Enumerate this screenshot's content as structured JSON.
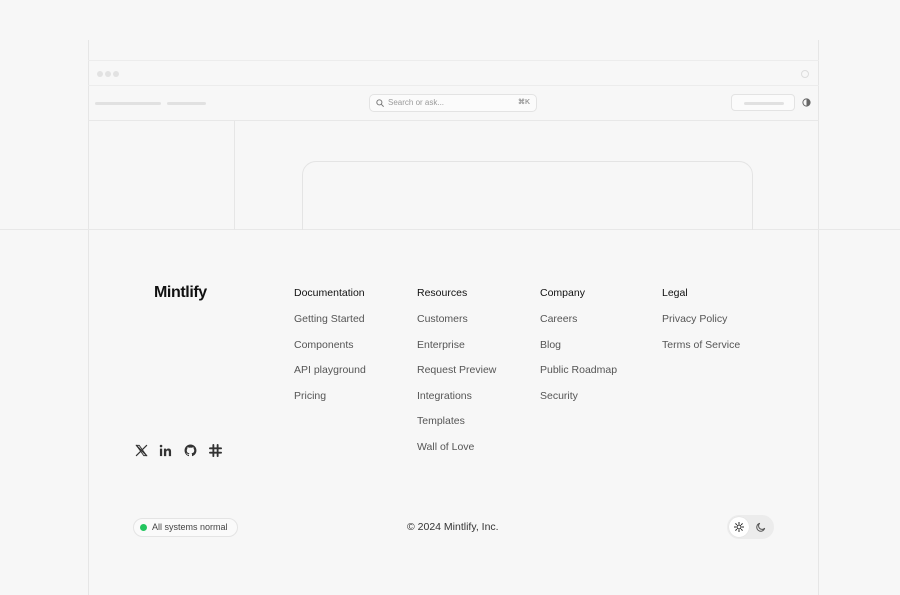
{
  "mock_window": {
    "search_placeholder": "Search or ask...",
    "search_shortcut": "⌘K"
  },
  "footer": {
    "logo": "Mintlify",
    "columns": [
      {
        "heading": "Documentation",
        "links": [
          "Getting Started",
          "Components",
          "API playground",
          "Pricing"
        ]
      },
      {
        "heading": "Resources",
        "links": [
          "Customers",
          "Enterprise",
          "Request Preview",
          "Integrations",
          "Templates",
          "Wall of Love"
        ]
      },
      {
        "heading": "Company",
        "links": [
          "Careers",
          "Blog",
          "Public Roadmap",
          "Security"
        ]
      },
      {
        "heading": "Legal",
        "links": [
          "Privacy Policy",
          "Terms of Service"
        ]
      }
    ],
    "social_icons": [
      "x-icon",
      "linkedin-icon",
      "github-icon",
      "slack-icon"
    ],
    "status_text": "All systems normal",
    "status_color": "#22c55e",
    "copyright": "© 2024 Mintlify, Inc.",
    "theme_options": [
      "sun-icon",
      "moon-icon"
    ],
    "theme_selected": "light"
  }
}
